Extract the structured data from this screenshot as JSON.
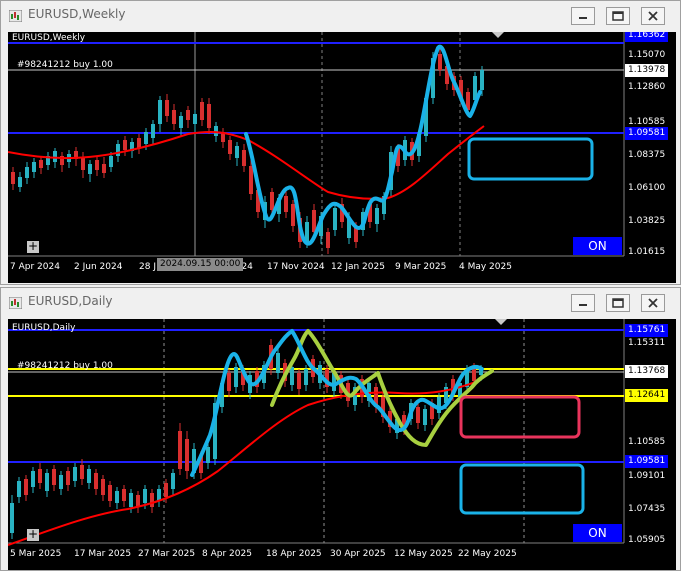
{
  "windows": {
    "weekly": {
      "title": "EURUSD,Weekly",
      "chart_label": "EURUSD,Weekly",
      "order_label": "#98241212 buy 1.00",
      "on_badge": "ON",
      "price_labels": [
        "1.15070",
        "1.12860",
        "1.10585",
        "1.08375",
        "1.06100",
        "1.03825",
        "1.01615"
      ],
      "price_markers": [
        {
          "text": "1.16362",
          "bg": "#0000ff",
          "fg": "#ffffff"
        },
        {
          "text": "1.13978",
          "bg": "#ffffff",
          "fg": "#000000"
        },
        {
          "text": "1.09581",
          "bg": "#0000ff",
          "fg": "#ffffff"
        }
      ],
      "date_labels": [
        "7 Apr 2024",
        "2 Jun 2024",
        "28 J",
        "2024.09.15 00:00",
        "2024",
        "17 Nov 2024",
        "12 Jan 2025",
        "9 Mar 2025",
        "4 May 2025"
      ]
    },
    "daily": {
      "title": "EURUSD,Daily",
      "chart_label": "EURUSD,Daily",
      "order_label": "#98241212 buy 1.00",
      "on_badge": "ON",
      "price_labels": [
        "1.15311",
        "1.12641",
        "1.10585",
        "1.09101",
        "1.07435",
        "1.05905"
      ],
      "price_markers": [
        {
          "text": "1.15761",
          "bg": "#0000ff",
          "fg": "#ffffff"
        },
        {
          "text": "1.13768",
          "bg": "#ffffff",
          "fg": "#000000"
        },
        {
          "text": "1.12641",
          "bg": "#ffff00",
          "fg": "#000000"
        },
        {
          "text": "1.09581",
          "bg": "#0000ff",
          "fg": "#ffffff"
        }
      ],
      "date_labels": [
        "5 Mar 2025",
        "17 Mar 2025",
        "27 Mar 2025",
        "8 Apr 2025",
        "18 Apr 2025",
        "30 Apr 2025",
        "12 May 2025",
        "22 May 2025"
      ]
    }
  },
  "colors": {
    "bull": "#29b3c3",
    "bear": "#d92f2f",
    "ma": "#ff0000",
    "hand_blue": "#1ab2e8",
    "hand_green": "#a8d040",
    "hand_pink": "#e8345c",
    "level_blue": "#0000ff",
    "level_yellow": "#ffff00"
  }
}
